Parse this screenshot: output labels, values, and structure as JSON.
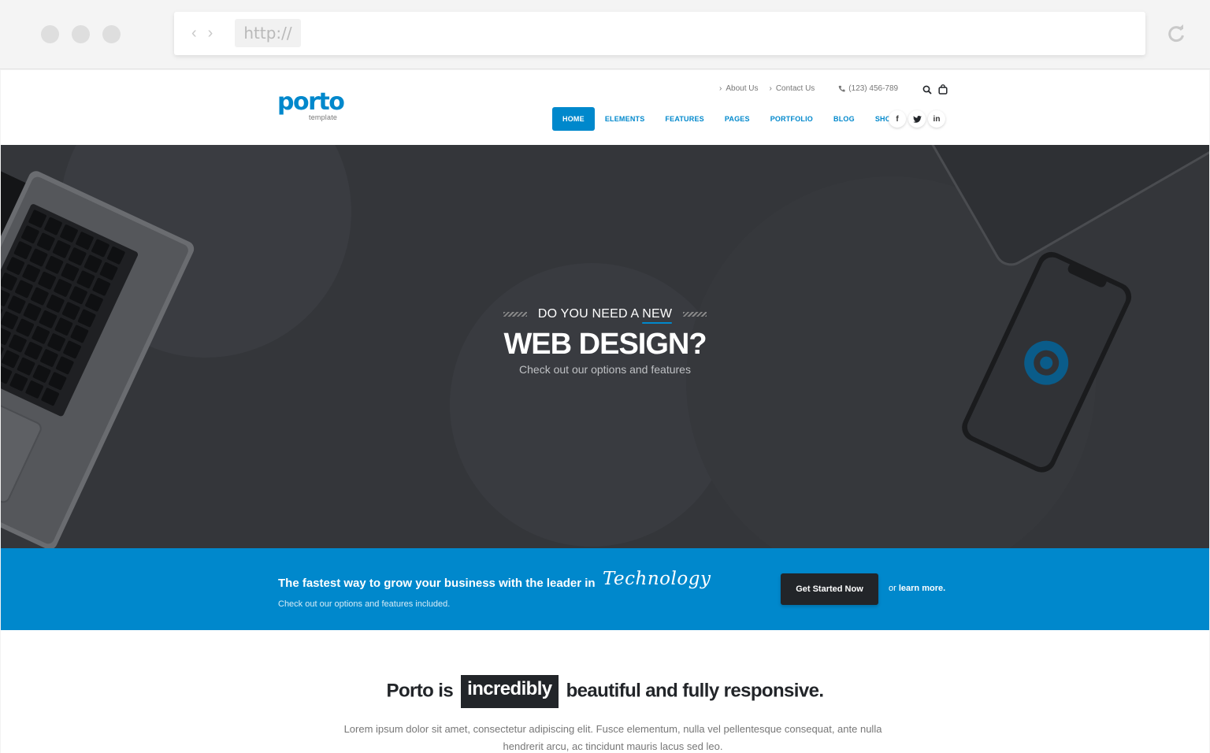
{
  "browser": {
    "url_placeholder": "http://"
  },
  "header": {
    "logo_word": "porto",
    "logo_sub": "template",
    "top_links": [
      "About Us",
      "Contact Us"
    ],
    "phone": "(123) 456-789",
    "nav": [
      "HOME",
      "ELEMENTS",
      "FEATURES",
      "PAGES",
      "PORTFOLIO",
      "BLOG",
      "SHOP"
    ],
    "social": [
      "f",
      "t",
      "in"
    ]
  },
  "hero": {
    "kicker_prefix": "DO YOU NEED A",
    "kicker_new": "NEW",
    "title": "WEB DESIGN?",
    "subtitle": "Check out our options and features"
  },
  "cta": {
    "title": "The fastest way to grow your business with the leader in",
    "script_word": "Technology",
    "subtitle": "Check out our options and features included.",
    "button": "Get Started Now",
    "or_text": "or",
    "learn_more": "learn more."
  },
  "content": {
    "title_before": "Porto is",
    "title_highlight": "incredibly",
    "title_after": "beautiful and fully responsive.",
    "paragraph": "Lorem ipsum dolor sit amet, consectetur adipiscing elit. Fusce elementum, nulla vel pellentesque consequat, ante nulla hendrerit arcu, ac tincidunt mauris lacus sed leo."
  },
  "colors": {
    "primary": "#0088cc",
    "dark": "#222529",
    "hero_bg": "#34363a"
  }
}
